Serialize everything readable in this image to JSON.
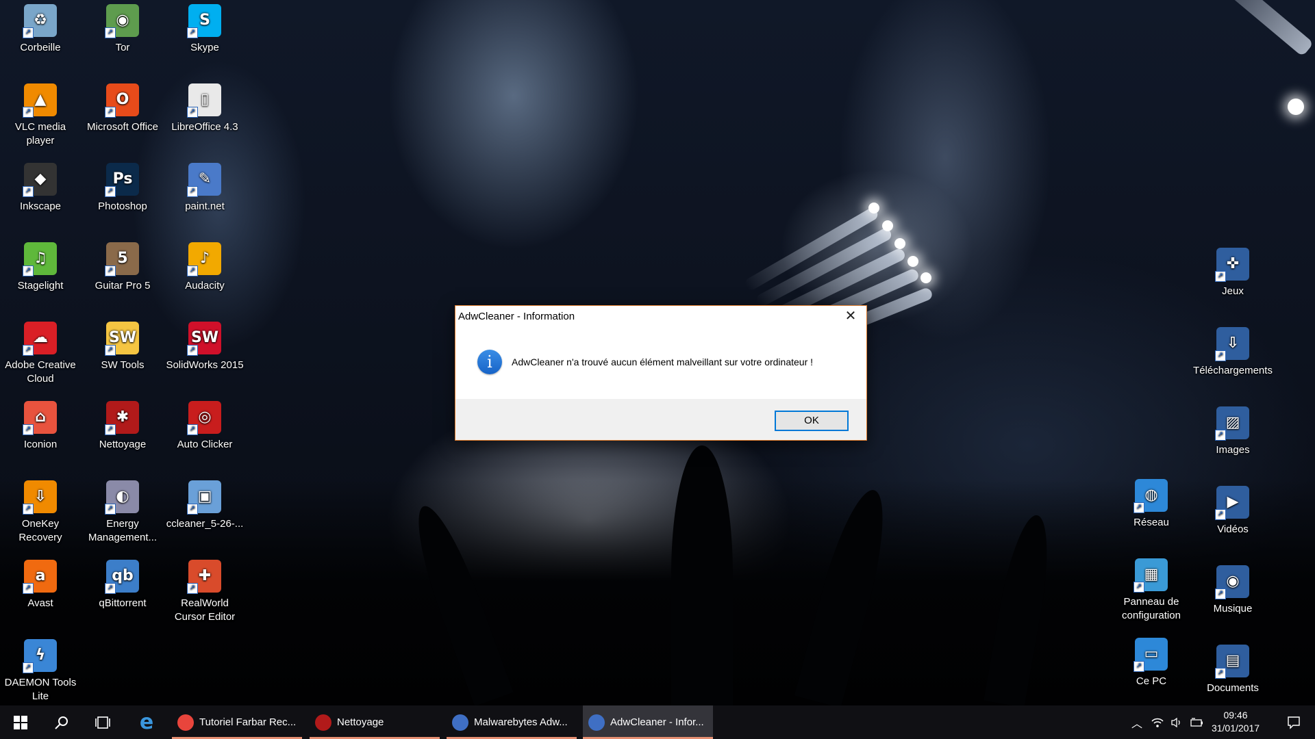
{
  "desktop_icons_left": [
    {
      "label": "Corbeille",
      "icon": "recycle-bin-icon",
      "color": "#7aa6c9",
      "glyph": "♻"
    },
    {
      "label": "Tor",
      "icon": "tor-globe-icon",
      "color": "#5e9c4e",
      "glyph": "◉"
    },
    {
      "label": "Skype",
      "icon": "skype-icon",
      "color": "#00aff0",
      "glyph": "S"
    },
    {
      "label": "VLC media player",
      "icon": "vlc-cone-icon",
      "color": "#f08a00",
      "glyph": "▲"
    },
    {
      "label": "Microsoft Office",
      "icon": "office-icon",
      "color": "#e74b1a",
      "glyph": "O"
    },
    {
      "label": "LibreOffice 4.3",
      "icon": "libreoffice-icon",
      "color": "#e9e9e9",
      "glyph": "▯"
    },
    {
      "label": "Inkscape",
      "icon": "inkscape-icon",
      "color": "#333333",
      "glyph": "◆"
    },
    {
      "label": "Photoshop",
      "icon": "photoshop-icon",
      "color": "#0b2a4a",
      "glyph": "Ps"
    },
    {
      "label": "paint.net",
      "icon": "paintnet-icon",
      "color": "#4a7ac9",
      "glyph": "✎"
    },
    {
      "label": "Stagelight",
      "icon": "stagelight-icon",
      "color": "#5fb83b",
      "glyph": "♫"
    },
    {
      "label": "Guitar Pro 5",
      "icon": "guitar-pro-icon",
      "color": "#8a6a4a",
      "glyph": "5"
    },
    {
      "label": "Audacity",
      "icon": "audacity-icon",
      "color": "#f2a900",
      "glyph": "♪"
    },
    {
      "label": "Adobe Creative Cloud",
      "icon": "creative-cloud-icon",
      "color": "#da1f26",
      "glyph": "☁"
    },
    {
      "label": "SW Tools",
      "icon": "sw-tools-icon",
      "color": "#f5c542",
      "glyph": "SW"
    },
    {
      "label": "SolidWorks 2015",
      "icon": "solidworks-icon",
      "color": "#d0102a",
      "glyph": "SW"
    },
    {
      "label": "Iconion",
      "icon": "iconion-icon",
      "color": "#e8533e",
      "glyph": "⌂"
    },
    {
      "label": "Nettoyage",
      "icon": "nettoyage-icon",
      "color": "#b11a1a",
      "glyph": "✱"
    },
    {
      "label": "Auto Clicker",
      "icon": "auto-clicker-icon",
      "color": "#c81d1d",
      "glyph": "◎"
    },
    {
      "label": "OneKey Recovery",
      "icon": "onekey-recovery-icon",
      "color": "#f08a00",
      "glyph": "⇩"
    },
    {
      "label": "Energy Management...",
      "icon": "energy-management-icon",
      "color": "#8a8aa8",
      "glyph": "◐"
    },
    {
      "label": "ccleaner_5-26-...",
      "icon": "ccleaner-installer-icon",
      "color": "#6aa0d8",
      "glyph": "▣"
    },
    {
      "label": "Avast",
      "icon": "avast-icon",
      "color": "#f06a10",
      "glyph": "a"
    },
    {
      "label": "qBittorrent",
      "icon": "qbittorrent-icon",
      "color": "#3c7ec9",
      "glyph": "qb"
    },
    {
      "label": "RealWorld Cursor Editor",
      "icon": "cursor-editor-icon",
      "color": "#d94b2b",
      "glyph": "✚"
    },
    {
      "label": "DAEMON Tools Lite",
      "icon": "daemon-tools-icon",
      "color": "#3a86d6",
      "glyph": "ϟ"
    }
  ],
  "desktop_icons_right": [
    {
      "label": "Jeux",
      "icon": "gamepad-icon",
      "color": "#2f5e9e",
      "glyph": "✜"
    },
    {
      "label": "Téléchargements",
      "icon": "downloads-folder-icon",
      "color": "#2f5e9e",
      "glyph": "⇩"
    },
    {
      "label": "Images",
      "icon": "pictures-folder-icon",
      "color": "#2f5e9e",
      "glyph": "▨"
    },
    {
      "label": "Réseau",
      "icon": "network-icon",
      "color": "#2d88d8",
      "glyph": "◍"
    },
    {
      "label": "Vidéos",
      "icon": "videos-folder-icon",
      "color": "#2f5e9e",
      "glyph": "▶"
    },
    {
      "label": "Panneau de configuration",
      "icon": "control-panel-icon",
      "color": "#3a9ad6",
      "glyph": "▦"
    },
    {
      "label": "Musique",
      "icon": "music-folder-icon",
      "color": "#2f5e9e",
      "glyph": "◉"
    },
    {
      "label": "Ce PC",
      "icon": "this-pc-icon",
      "color": "#2d88d8",
      "glyph": "▭"
    },
    {
      "label": "Documents",
      "icon": "documents-folder-icon",
      "color": "#2f5e9e",
      "glyph": "▤"
    }
  ],
  "dialog": {
    "title": "AdwCleaner - Information",
    "message": "AdwCleaner n'a trouvé aucun élément malveillant sur votre ordinateur !",
    "ok_label": "OK",
    "close_glyph": "✕",
    "info_glyph": "i"
  },
  "taskbar": {
    "tasks": [
      {
        "label": "Tutoriel Farbar Rec...",
        "icon": "chrome-icon",
        "color": "#e8453c",
        "active": false
      },
      {
        "label": "Nettoyage",
        "icon": "nettoyage-icon",
        "color": "#b11a1a",
        "active": false
      },
      {
        "label": "Malwarebytes Adw...",
        "icon": "malwarebytes-adwcleaner-icon",
        "color": "#3f6fc4",
        "active": false
      },
      {
        "label": "AdwCleaner - Infor...",
        "icon": "adwcleaner-icon",
        "color": "#3f6fc4",
        "active": true
      }
    ],
    "time": "09:46",
    "date": "31/01/2017",
    "accent_underline": "#e58f72"
  }
}
